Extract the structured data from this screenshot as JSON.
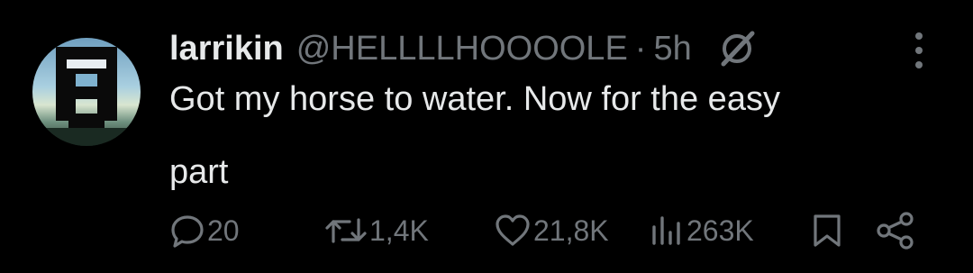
{
  "tweet": {
    "author_name": "larrikin",
    "author_handle": "@HELLLLHOOOOLE",
    "separator": "·",
    "timestamp": "5h",
    "text_lines": [
      "Got my horse to water. Now for the easy",
      "part"
    ]
  },
  "actions": {
    "replies": "20",
    "retweets": "1,4K",
    "likes": "21,8K",
    "views": "263K"
  },
  "icons": {
    "reply": "reply-icon",
    "retweet": "retweet-icon",
    "like": "heart-icon",
    "views": "views-chart-icon",
    "bookmark": "bookmark-icon",
    "share": "share-icon",
    "more": "more-options-icon",
    "badge": "grok-icon"
  },
  "colors": {
    "background": "#000000",
    "primary_text": "#e7e9ea",
    "secondary_text": "#71767b"
  }
}
